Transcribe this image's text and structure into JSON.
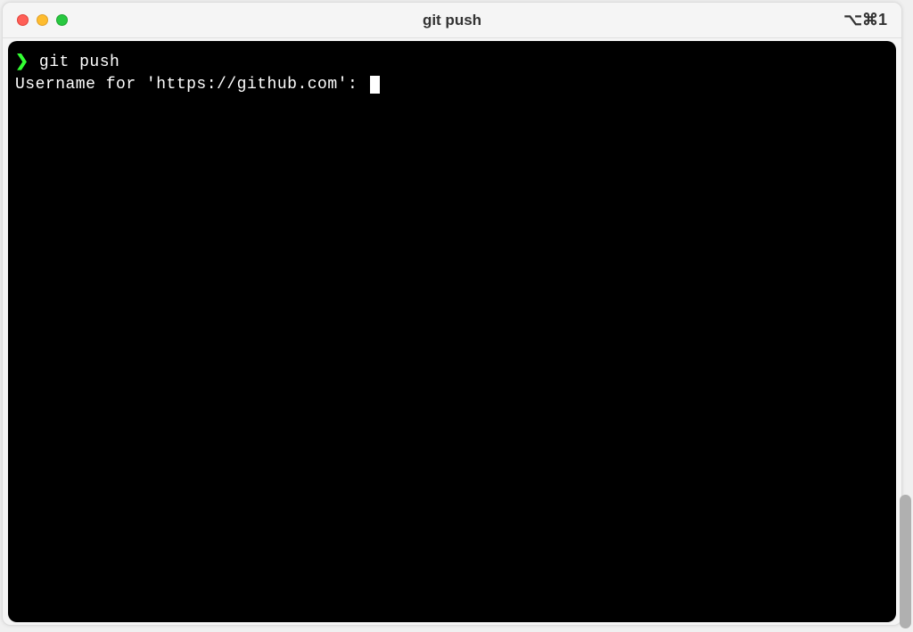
{
  "titlebar": {
    "title": "git push",
    "shortcut": "⌥⌘1"
  },
  "terminal": {
    "prompt_symbol": "❯",
    "command": "git push",
    "output_line": "Username for 'https://github.com': "
  }
}
